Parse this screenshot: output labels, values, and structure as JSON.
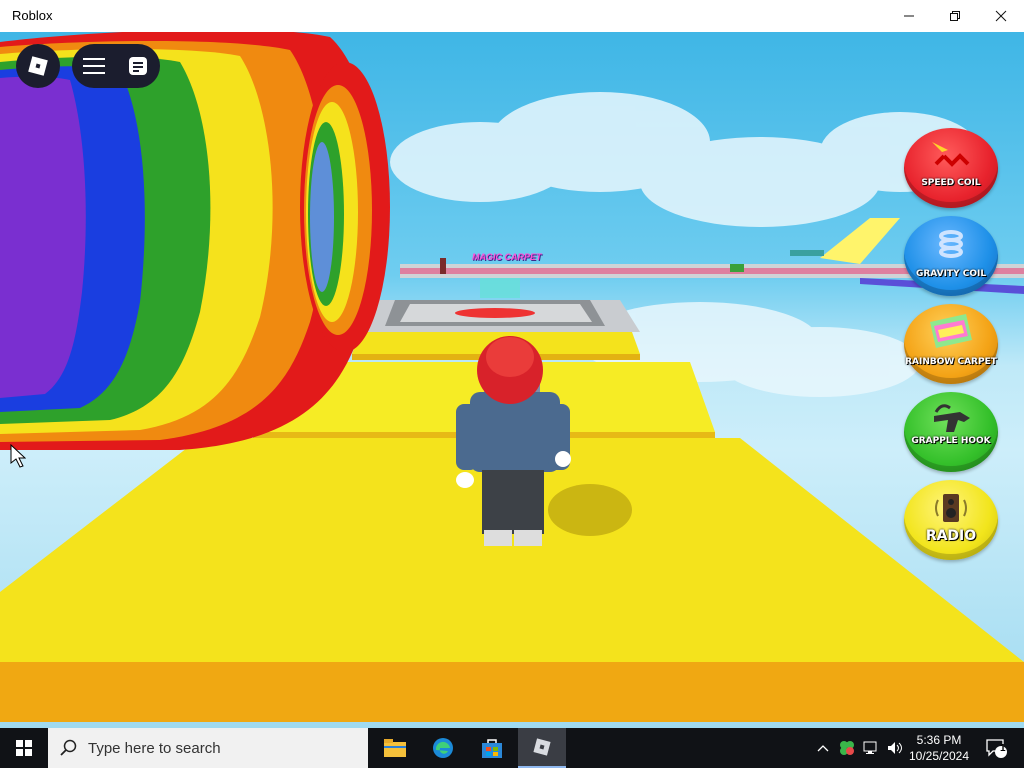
{
  "window": {
    "title": "Roblox",
    "controls": [
      "minimize",
      "maximize",
      "close"
    ]
  },
  "game": {
    "world_labels": [
      "MAGIC CARPET"
    ],
    "side_buttons": [
      {
        "id": "speed-coil",
        "label": "SPEED COIL",
        "color": "#e8232d"
      },
      {
        "id": "gravity-coil",
        "label": "GRAVITY COIL",
        "color": "#1e90e8"
      },
      {
        "id": "rainbow-carpet",
        "label": "RAINBOW CARPET",
        "color": "#f4a316"
      },
      {
        "id": "grapple-hook",
        "label": "GRAPPLE HOOK",
        "color": "#34c02a"
      },
      {
        "id": "radio",
        "label": "RADIO",
        "color": "#f2e51c"
      }
    ]
  },
  "taskbar": {
    "search_placeholder": "Type here to search",
    "time": "5:36 PM",
    "date": "10/25/2024",
    "notification_count": "1",
    "pinned_apps": [
      "file-explorer",
      "edge",
      "microsoft-store",
      "roblox"
    ]
  }
}
